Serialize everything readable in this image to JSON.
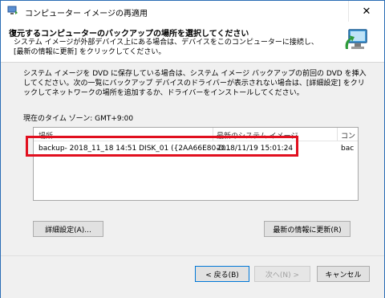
{
  "window": {
    "title": "コンピューター イメージの再適用",
    "close_label": "✕"
  },
  "header": {
    "title": "復元するコンピューターのバックアップの場所を選択してください",
    "description": "システム イメージが外部デバイス上にある場合は、デバイスをこのコンピューターに接続し、[最新の情報に更新] をクリックしてください。"
  },
  "main": {
    "intro": "システム イメージを DVD に保存している場合は、システム イメージ バックアップの前回の DVD を挿入してください。次の一覧にバックアップ デバイスのドライバーが表示されない場合は、[詳細設定] をクリックしてネットワークの場所を追加するか、ドライバーをインストールしてください。",
    "timezone": "現在のタイム ゾーン: GMT+9:00",
    "table": {
      "columns": [
        "場所",
        "最新のシステム イメージ",
        "コン"
      ],
      "rows": [
        {
          "location": "backup- 2018_11_18 14:51 DISK_01 ({2AA66E80-D...",
          "latest_image": "2018/11/19 15:01:24",
          "computer": "bac"
        }
      ]
    },
    "advanced_button": "詳細設定(A)...",
    "refresh_button": "最新の情報に更新(R)"
  },
  "footer": {
    "back_button": "< 戻る(B)",
    "next_button": "次へ(N) >",
    "cancel_button": "キャンセル"
  },
  "colors": {
    "highlight_box": "#e1101f",
    "desktop_border": "#1f63a8"
  }
}
